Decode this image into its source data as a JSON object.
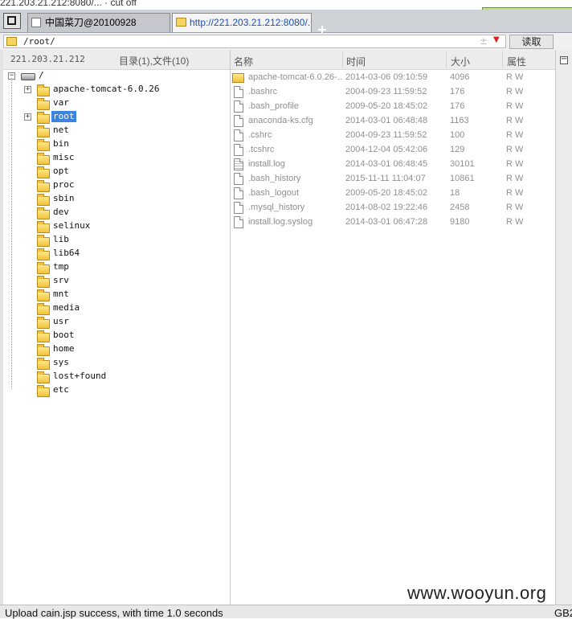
{
  "top_strip_text": "221.203.21.212:8080/... · cut off",
  "tabs": [
    {
      "label": "中国菜刀@20100928",
      "active": false
    },
    {
      "label": "http://221.203.21.212:8080/...",
      "active": true
    }
  ],
  "new_tab_label": "+",
  "path_bar": {
    "value": "/root/",
    "read_button": "读取",
    "plus_minus": "±"
  },
  "left_pane": {
    "host": "221.203.21.212",
    "summary": "目录(1),文件(10)",
    "root_label": "/",
    "tree": [
      {
        "label": "apache-tomcat-6.0.26",
        "expandable": true,
        "selected": false
      },
      {
        "label": "var",
        "expandable": false,
        "selected": false
      },
      {
        "label": "root",
        "expandable": true,
        "selected": true
      },
      {
        "label": "net",
        "expandable": false,
        "selected": false
      },
      {
        "label": "bin",
        "expandable": false,
        "selected": false
      },
      {
        "label": "misc",
        "expandable": false,
        "selected": false
      },
      {
        "label": "opt",
        "expandable": false,
        "selected": false
      },
      {
        "label": "proc",
        "expandable": false,
        "selected": false
      },
      {
        "label": "sbin",
        "expandable": false,
        "selected": false
      },
      {
        "label": "dev",
        "expandable": false,
        "selected": false
      },
      {
        "label": "selinux",
        "expandable": false,
        "selected": false
      },
      {
        "label": "lib",
        "expandable": false,
        "selected": false
      },
      {
        "label": "lib64",
        "expandable": false,
        "selected": false
      },
      {
        "label": "tmp",
        "expandable": false,
        "selected": false
      },
      {
        "label": "srv",
        "expandable": false,
        "selected": false
      },
      {
        "label": "mnt",
        "expandable": false,
        "selected": false
      },
      {
        "label": "media",
        "expandable": false,
        "selected": false
      },
      {
        "label": "usr",
        "expandable": false,
        "selected": false
      },
      {
        "label": "boot",
        "expandable": false,
        "selected": false
      },
      {
        "label": "home",
        "expandable": false,
        "selected": false
      },
      {
        "label": "sys",
        "expandable": false,
        "selected": false
      },
      {
        "label": "lost+found",
        "expandable": false,
        "selected": false
      },
      {
        "label": "etc",
        "expandable": false,
        "selected": false
      }
    ]
  },
  "file_list": {
    "columns": {
      "name": "名称",
      "time": "时间",
      "size": "大小",
      "attr": "属性"
    },
    "rows": [
      {
        "type": "folder",
        "name": "apache-tomcat-6.0.26-...",
        "time": "2014-03-06 09:10:59",
        "size": "4096",
        "attr": "R W"
      },
      {
        "type": "file",
        "name": ".bashrc",
        "time": "2004-09-23 11:59:52",
        "size": "176",
        "attr": "R W"
      },
      {
        "type": "file",
        "name": ".bash_profile",
        "time": "2009-05-20 18:45:02",
        "size": "176",
        "attr": "R W"
      },
      {
        "type": "file",
        "name": "anaconda-ks.cfg",
        "time": "2014-03-01 06:48:48",
        "size": "1163",
        "attr": "R W"
      },
      {
        "type": "file",
        "name": ".cshrc",
        "time": "2004-09-23 11:59:52",
        "size": "100",
        "attr": "R W"
      },
      {
        "type": "file",
        "name": ".tcshrc",
        "time": "2004-12-04 05:42:06",
        "size": "129",
        "attr": "R W"
      },
      {
        "type": "text",
        "name": "install.log",
        "time": "2014-03-01 06:48:45",
        "size": "30101",
        "attr": "R W"
      },
      {
        "type": "file",
        "name": ".bash_history",
        "time": "2015-11-11 11:04:07",
        "size": "10861",
        "attr": "R W"
      },
      {
        "type": "file",
        "name": ".bash_logout",
        "time": "2009-05-20 18:45:02",
        "size": "18",
        "attr": "R W"
      },
      {
        "type": "file",
        "name": ".mysql_history",
        "time": "2014-08-02 19:22:46",
        "size": "2458",
        "attr": "R W"
      },
      {
        "type": "file",
        "name": "install.log.syslog",
        "time": "2014-03-01 06:47:28",
        "size": "9180",
        "attr": "R W"
      }
    ]
  },
  "status_bar": {
    "message": "Upload cain.jsp success, with time 1.0 seconds",
    "encoding": "GB2"
  },
  "watermark": "www.wooyun.org",
  "colors": {
    "selection": "#3a83e0",
    "tab_active_text": "#1a4fb5",
    "folder": "#f1c23a"
  }
}
